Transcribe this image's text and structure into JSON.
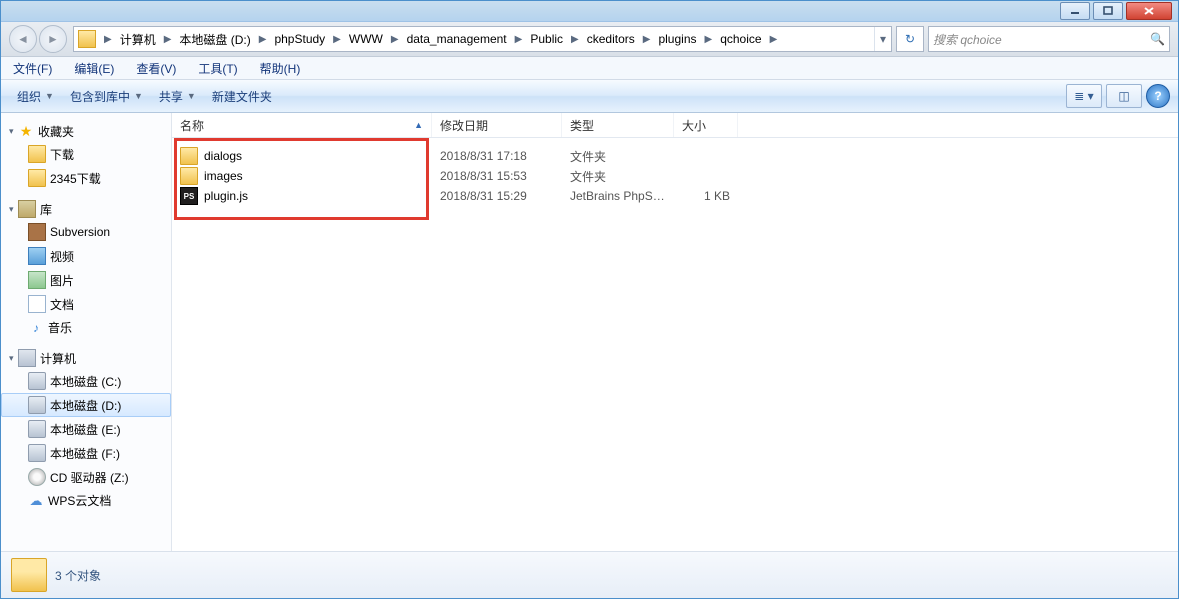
{
  "breadcrumbs": [
    "计算机",
    "本地磁盘 (D:)",
    "phpStudy",
    "WWW",
    "data_management",
    "Public",
    "ckeditors",
    "plugins",
    "qchoice"
  ],
  "search_placeholder": "搜索 qchoice",
  "menu": {
    "file": "文件(F)",
    "edit": "编辑(E)",
    "view": "查看(V)",
    "tools": "工具(T)",
    "help": "帮助(H)"
  },
  "tool": {
    "organize": "组织",
    "include": "包含到库中",
    "share": "共享",
    "newfolder": "新建文件夹"
  },
  "nav": {
    "fav": "收藏夹",
    "download": "下载",
    "dl2345": "2345下载",
    "lib": "库",
    "svn": "Subversion",
    "video": "视频",
    "pic": "图片",
    "doc": "文档",
    "music": "音乐",
    "computer": "计算机",
    "c": "本地磁盘 (C:)",
    "d": "本地磁盘 (D:)",
    "e": "本地磁盘 (E:)",
    "f": "本地磁盘 (F:)",
    "z": "CD 驱动器 (Z:)",
    "wps": "WPS云文档"
  },
  "cols": {
    "name": "名称",
    "date": "修改日期",
    "type": "类型",
    "size": "大小"
  },
  "files": [
    {
      "name": "dialogs",
      "date": "2018/8/31 17:18",
      "type": "文件夹",
      "size": "",
      "icon": "folder"
    },
    {
      "name": "images",
      "date": "2018/8/31 15:53",
      "type": "文件夹",
      "size": "",
      "icon": "folder"
    },
    {
      "name": "plugin.js",
      "date": "2018/8/31 15:29",
      "type": "JetBrains PhpSto...",
      "size": "1 KB",
      "icon": "js"
    }
  ],
  "status": "3 个对象"
}
